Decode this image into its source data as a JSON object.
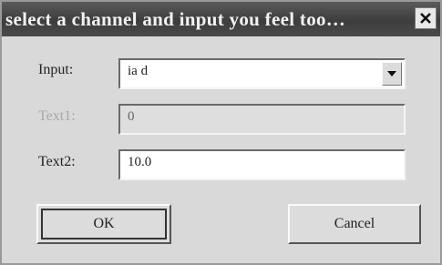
{
  "dialog": {
    "title": "select a channel and input you feel too…"
  },
  "fields": {
    "input_label": "Input:",
    "input_value": "ia d",
    "text1_label": "Text1:",
    "text1_value": "0",
    "text2_label": "Text2:",
    "text2_value": "10.0"
  },
  "buttons": {
    "ok_label": "OK",
    "cancel_label": "Cancel"
  },
  "icons": {
    "close": "close-icon",
    "dropdown": "chevron-down-icon"
  },
  "colors": {
    "titlebar": "#4a4a4a",
    "dialog_bg": "#d9d9d9"
  }
}
